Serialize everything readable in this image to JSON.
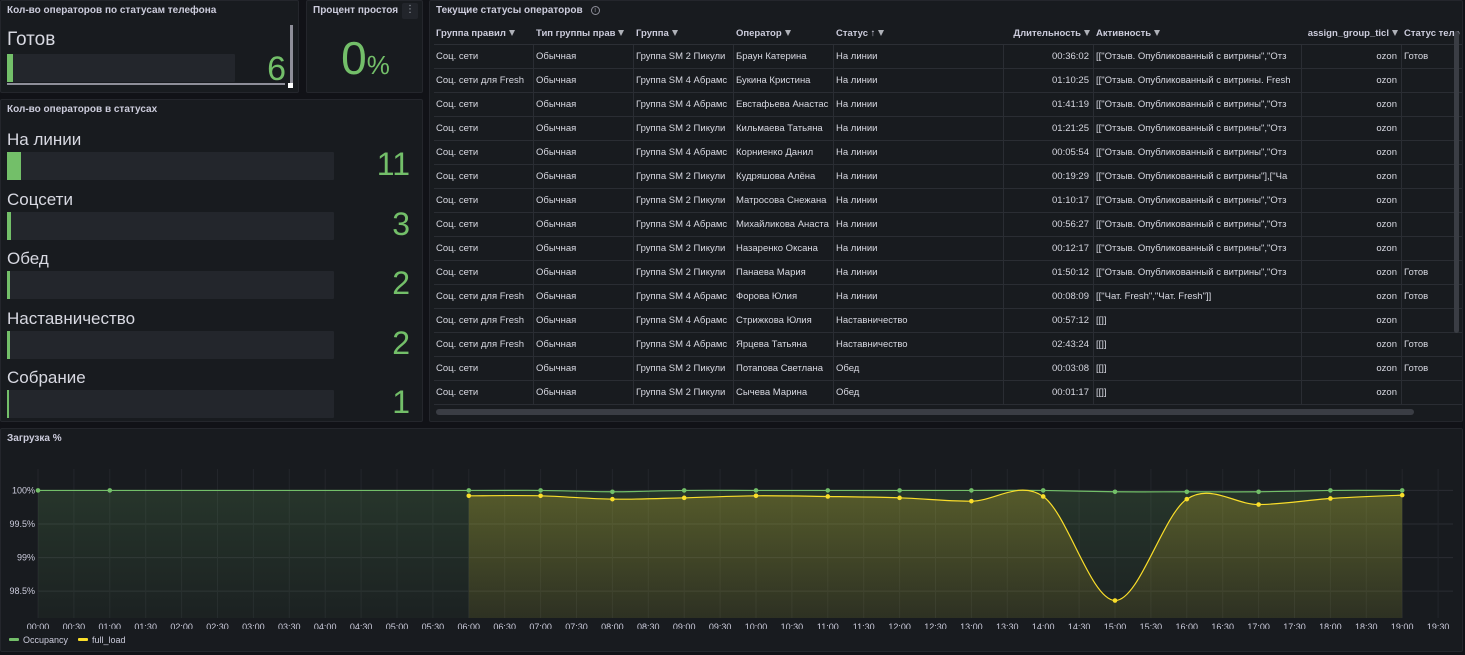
{
  "phone_panel": {
    "title": "Кол-во операторов по статусам телефона",
    "label": "Готов",
    "value": "6",
    "fraction": 0.5
  },
  "idle_panel": {
    "title": "Процент простоя",
    "value": "0",
    "unit": "%"
  },
  "status_panel": {
    "title": "Кол-во операторов в статусах",
    "items": [
      {
        "label": "На линии",
        "value": "11",
        "fraction": 1.0
      },
      {
        "label": "Соцсети",
        "value": "3",
        "fraction": 0.273
      },
      {
        "label": "Обед",
        "value": "2",
        "fraction": 0.182
      },
      {
        "label": "Наставничество",
        "value": "2",
        "fraction": 0.182
      },
      {
        "label": "Собрание",
        "value": "1",
        "fraction": 0.091
      }
    ]
  },
  "table_panel": {
    "title": "Текущие статусы операторов",
    "columns": [
      "Группа правил",
      "Тип группы прав",
      "Группа",
      "Оператор",
      "Статус",
      "Длительность",
      "Активность",
      "assign_group_ticl",
      "Статус теле"
    ],
    "rows": [
      [
        "Соц. сети",
        "Обычная",
        "Группа SM 2 Пикули",
        "Браун Катерина",
        "На линии",
        "00:36:02",
        "[[\"Отзыв. Опубликованный с витрины\",\"Отз",
        "ozon",
        "Готов"
      ],
      [
        "Соц. сети для Fresh",
        "Обычная",
        "Группа SM 4 Абрамс",
        "Букина Кристина",
        "На линии",
        "01:10:25",
        "[[\"Отзыв. Опубликованный с витрины. Fresh",
        "ozon",
        ""
      ],
      [
        "Соц. сети",
        "Обычная",
        "Группа SM 4 Абрамс",
        "Евстафьева Анастас",
        "На линии",
        "01:41:19",
        "[[\"Отзыв. Опубликованный с витрины\",\"Отз",
        "ozon",
        ""
      ],
      [
        "Соц. сети",
        "Обычная",
        "Группа SM 2 Пикули",
        "Кильмаева Татьяна",
        "На линии",
        "01:21:25",
        "[[\"Отзыв. Опубликованный с витрины\",\"Отз",
        "ozon",
        ""
      ],
      [
        "Соц. сети",
        "Обычная",
        "Группа SM 4 Абрамс",
        "Корниенко Данил",
        "На линии",
        "00:05:54",
        "[[\"Отзыв. Опубликованный с витрины\",\"Отз",
        "ozon",
        ""
      ],
      [
        "Соц. сети",
        "Обычная",
        "Группа SM 2 Пикули",
        "Кудряшова Алёна",
        "На линии",
        "00:19:29",
        "[[\"Отзыв. Опубликованный с витрины\"],[\"Ча",
        "ozon",
        ""
      ],
      [
        "Соц. сети",
        "Обычная",
        "Группа SM 2 Пикули",
        "Матросова Снежана",
        "На линии",
        "01:10:17",
        "[[\"Отзыв. Опубликованный с витрины\",\"Отз",
        "ozon",
        ""
      ],
      [
        "Соц. сети",
        "Обычная",
        "Группа SM 4 Абрамс",
        "Михайликова Анаста",
        "На линии",
        "00:56:27",
        "[[\"Отзыв. Опубликованный с витрины\",\"Отз",
        "ozon",
        ""
      ],
      [
        "Соц. сети",
        "Обычная",
        "Группа SM 2 Пикули",
        "Назаренко Оксана",
        "На линии",
        "00:12:17",
        "[[\"Отзыв. Опубликованный с витрины\",\"Отз",
        "ozon",
        ""
      ],
      [
        "Соц. сети",
        "Обычная",
        "Группа SM 2 Пикули",
        "Панаева Мария",
        "На линии",
        "01:50:12",
        "[[\"Отзыв. Опубликованный с витрины\",\"Отз",
        "ozon",
        "Готов"
      ],
      [
        "Соц. сети для Fresh",
        "Обычная",
        "Группа SM 4 Абрамс",
        "Форова Юлия",
        "На линии",
        "00:08:09",
        "[[\"Чат. Fresh\",\"Чат. Fresh\"]]",
        "ozon",
        "Готов"
      ],
      [
        "Соц. сети для Fresh",
        "Обычная",
        "Группа SM 4 Абрамс",
        "Стрижкова Юлия",
        "Наставничество",
        "00:57:12",
        "[[]]",
        "ozon",
        ""
      ],
      [
        "Соц. сети для Fresh",
        "Обычная",
        "Группа SM 4 Абрамс",
        "Ярцева Татьяна",
        "Наставничество",
        "02:43:24",
        "[[]]",
        "ozon",
        "Готов"
      ],
      [
        "Соц. сети",
        "Обычная",
        "Группа SM 2 Пикули",
        "Потапова Светлана",
        "Обед",
        "00:03:08",
        "[[]]",
        "ozon",
        "Готов"
      ],
      [
        "Соц. сети",
        "Обычная",
        "Группа SM 2 Пикули",
        "Сычева Марина",
        "Обед",
        "00:01:17",
        "[[]]",
        "ozon",
        ""
      ]
    ]
  },
  "load_panel": {
    "title": "Загрузка %"
  },
  "colors": {
    "green": "#73bf69",
    "yellow": "#fade2a",
    "background": "#111217",
    "panel": "#181b1f"
  },
  "chart_data": {
    "type": "line",
    "title": "Загрузка %",
    "xlabel": "",
    "ylabel": "",
    "x_ticks": [
      "00:00",
      "00:30",
      "01:00",
      "01:30",
      "02:00",
      "02:30",
      "03:00",
      "03:30",
      "04:00",
      "04:30",
      "05:00",
      "05:30",
      "06:00",
      "06:30",
      "07:00",
      "07:30",
      "08:00",
      "08:30",
      "09:00",
      "09:30",
      "10:00",
      "10:30",
      "11:00",
      "11:30",
      "12:00",
      "12:30",
      "13:00",
      "13:30",
      "14:00",
      "14:30",
      "15:00",
      "15:30",
      "16:00",
      "16:30",
      "17:00",
      "17:30",
      "18:00",
      "18:30",
      "19:00",
      "19:30"
    ],
    "y_ticks": [
      "100%",
      "99.5%",
      "99%",
      "98.5%"
    ],
    "ylim": [
      98.1,
      100.2
    ],
    "grid": true,
    "legend_placement": "bottom-left",
    "series": [
      {
        "name": "Occupancy",
        "color": "#73bf69",
        "points": [
          [
            "00:00",
            100
          ],
          [
            "01:00",
            100
          ],
          [
            "06:00",
            100
          ],
          [
            "07:00",
            100
          ],
          [
            "08:00",
            99.98
          ],
          [
            "09:00",
            100
          ],
          [
            "10:00",
            100
          ],
          [
            "11:00",
            100
          ],
          [
            "12:00",
            100
          ],
          [
            "13:00",
            100
          ],
          [
            "14:00",
            100
          ],
          [
            "15:00",
            99.98
          ],
          [
            "16:00",
            99.98
          ],
          [
            "17:00",
            99.98
          ],
          [
            "18:00",
            100
          ],
          [
            "19:00",
            100
          ]
        ]
      },
      {
        "name": "full_load",
        "color": "#fade2a",
        "points": [
          [
            "06:00",
            99.92
          ],
          [
            "07:00",
            99.92
          ],
          [
            "08:00",
            99.87
          ],
          [
            "09:00",
            99.89
          ],
          [
            "10:00",
            99.92
          ],
          [
            "11:00",
            99.91
          ],
          [
            "12:00",
            99.89
          ],
          [
            "13:00",
            99.84
          ],
          [
            "14:00",
            99.91
          ],
          [
            "15:00",
            98.36
          ],
          [
            "16:00",
            99.87
          ],
          [
            "17:00",
            99.79
          ],
          [
            "18:00",
            99.88
          ],
          [
            "19:00",
            99.93
          ]
        ]
      }
    ]
  }
}
